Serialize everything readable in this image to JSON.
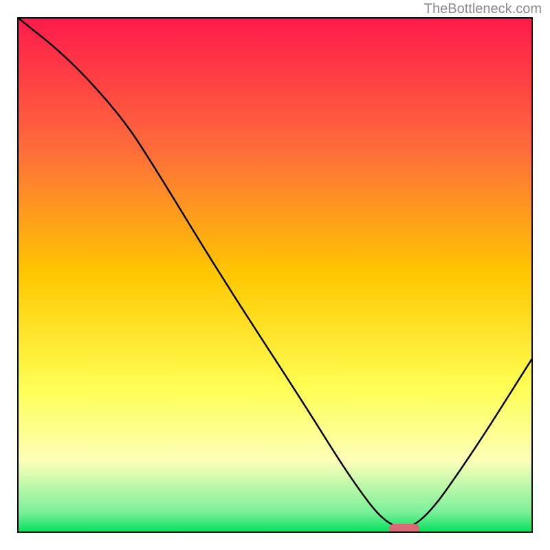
{
  "attribution": "TheBottleneck.com",
  "colors": {
    "top": "#ff1a4b",
    "mid1": "#ff7a33",
    "mid2": "#ffd400",
    "mid3": "#ffff66",
    "mid4": "#fbffc0",
    "bottom": "#00e05a",
    "curve": "#000000",
    "marker": "#d96a76",
    "frame": "#000000"
  },
  "chart_data": {
    "type": "line",
    "title": "",
    "xlabel": "",
    "ylabel": "",
    "xlim": [
      0,
      100
    ],
    "ylim": [
      0,
      100
    ],
    "series": [
      {
        "name": "bottleneck-curve",
        "x": [
          0,
          10,
          20,
          26,
          40,
          55,
          65,
          72,
          78,
          88,
          100
        ],
        "y": [
          100,
          92,
          81,
          72,
          49,
          26,
          10,
          1,
          1,
          15,
          34
        ]
      }
    ],
    "annotations": [
      {
        "name": "optimal-marker",
        "x": 75,
        "y": 0.8
      }
    ],
    "gradient_stops": [
      {
        "offset": 0.0,
        "color": "#ff1a4b"
      },
      {
        "offset": 0.25,
        "color": "#ff6a3c"
      },
      {
        "offset": 0.5,
        "color": "#ffc800"
      },
      {
        "offset": 0.72,
        "color": "#ffff55"
      },
      {
        "offset": 0.86,
        "color": "#fdffb8"
      },
      {
        "offset": 0.96,
        "color": "#7af09a"
      },
      {
        "offset": 1.0,
        "color": "#00e05a"
      }
    ]
  }
}
